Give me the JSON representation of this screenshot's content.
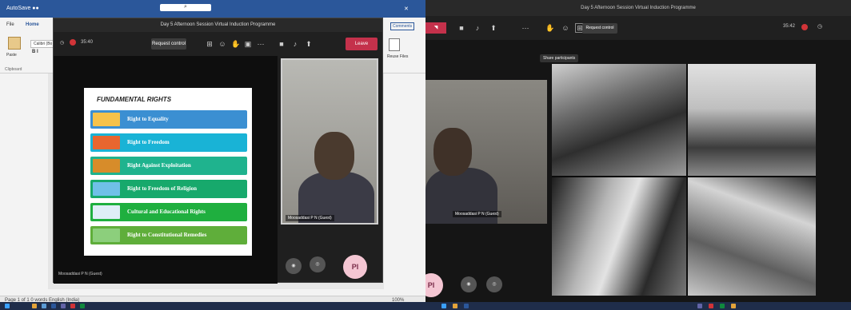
{
  "left": {
    "word": {
      "tabs": [
        "File",
        "Home"
      ],
      "paste_label": "Paste",
      "font_name": "Calibri (Bo",
      "clipboard_label": "Clipboard",
      "comments_label": "Comments",
      "rhs_label": "Reuse Files",
      "status_text": "Page 1 of 1   0 words   English (India)",
      "zoom": "100%"
    },
    "teams": {
      "title": "Day 5 Afternoon Session Virtual Induction Programme",
      "timer": "35:40",
      "request_control": "Request control",
      "leave": "Leave",
      "presenter_name": "Moosaddasi P N (Guest)",
      "avatar_initials": "PI"
    },
    "slide": {
      "title": "FUNDAMENTAL RIGHTS",
      "items": [
        {
          "label": "Right to Equality",
          "color": "#3b8fd2"
        },
        {
          "label": "Right to Freedom",
          "color": "#19b3d6"
        },
        {
          "label": "Right Against Exploitation",
          "color": "#1fb38e"
        },
        {
          "label": "Right to Freedom of Religion",
          "color": "#17a96c"
        },
        {
          "label": "Cultural and Educational Rights",
          "color": "#1faf3f"
        },
        {
          "label": "Right to Constitutional Remedies",
          "color": "#5fae3a"
        }
      ]
    }
  },
  "right": {
    "title": "Day 5 Afternoon Session Virtual Induction Programme",
    "request_control": "Request control",
    "tooltip": "Share participants",
    "timer": "35:42",
    "presenter_name": "Moosaddasi P N (Guest)",
    "avatar_initials": "PI"
  }
}
